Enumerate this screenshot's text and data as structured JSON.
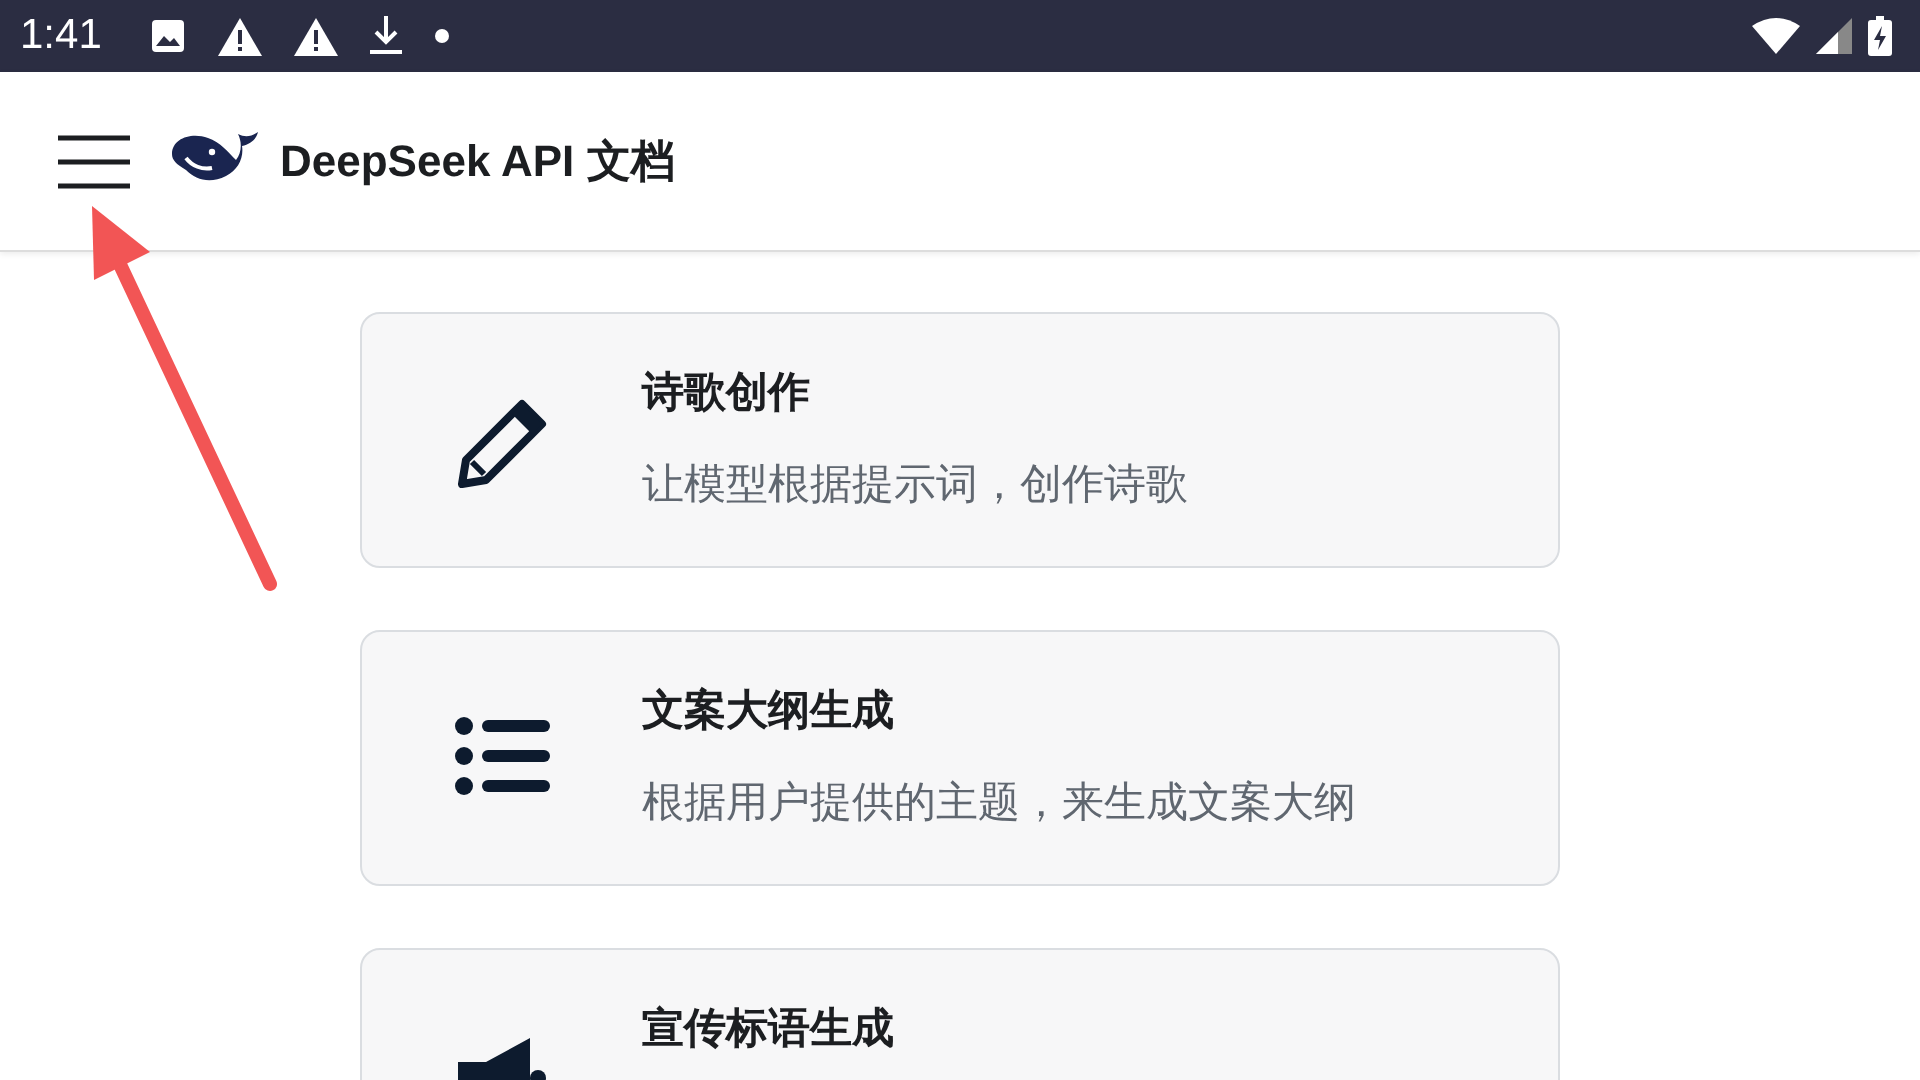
{
  "status_bar": {
    "time": "1:41"
  },
  "header": {
    "title": "DeepSeek API 文档"
  },
  "cards": [
    {
      "title": "诗歌创作",
      "description": "让模型根据提示词，创作诗歌"
    },
    {
      "title": "文案大纲生成",
      "description": "根据用户提供的主题，来生成文案大纲"
    },
    {
      "title": "宣传标语生成"
    }
  ]
}
